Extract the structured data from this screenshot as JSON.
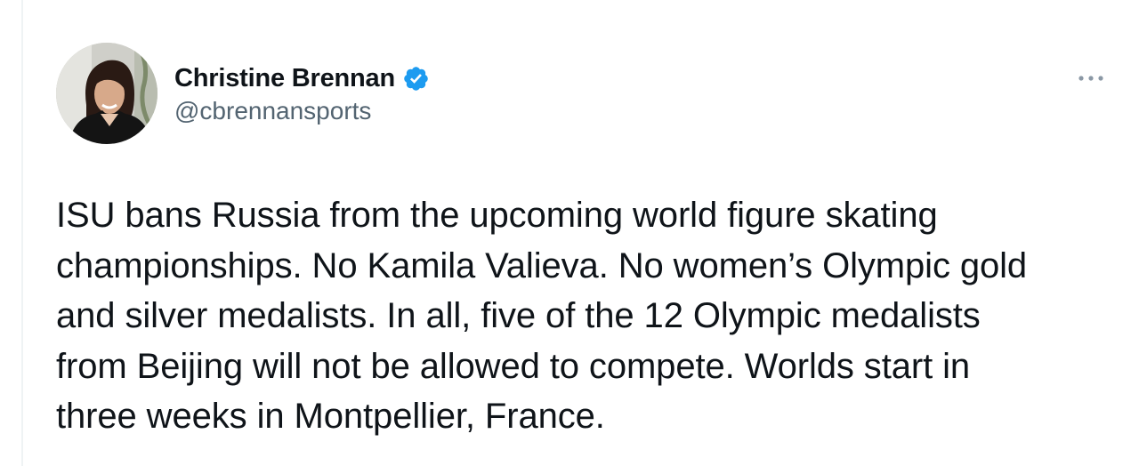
{
  "author": {
    "display_name": "Christine Brennan",
    "handle": "@cbrennansports",
    "verified": true,
    "avatar_icon": "profile-photo"
  },
  "tweet": {
    "lines": [
      "ISU bans Russia from the upcoming world figure skating",
      "championships. No Kamila Valieva. No women’s Olympic gold",
      "and silver medalists. In all, five of the 12 Olympic medalists",
      "from Beijing will not be allowed to compete. Worlds start in",
      "three weeks in Montpellier, France."
    ]
  },
  "icons": {
    "verified": "verified-badge-icon",
    "more": "more-options-icon"
  },
  "colors": {
    "text_primary": "#0f1419",
    "text_secondary": "#536471",
    "verified_blue": "#1d9bf0",
    "more_dots": "#8b98a5"
  }
}
